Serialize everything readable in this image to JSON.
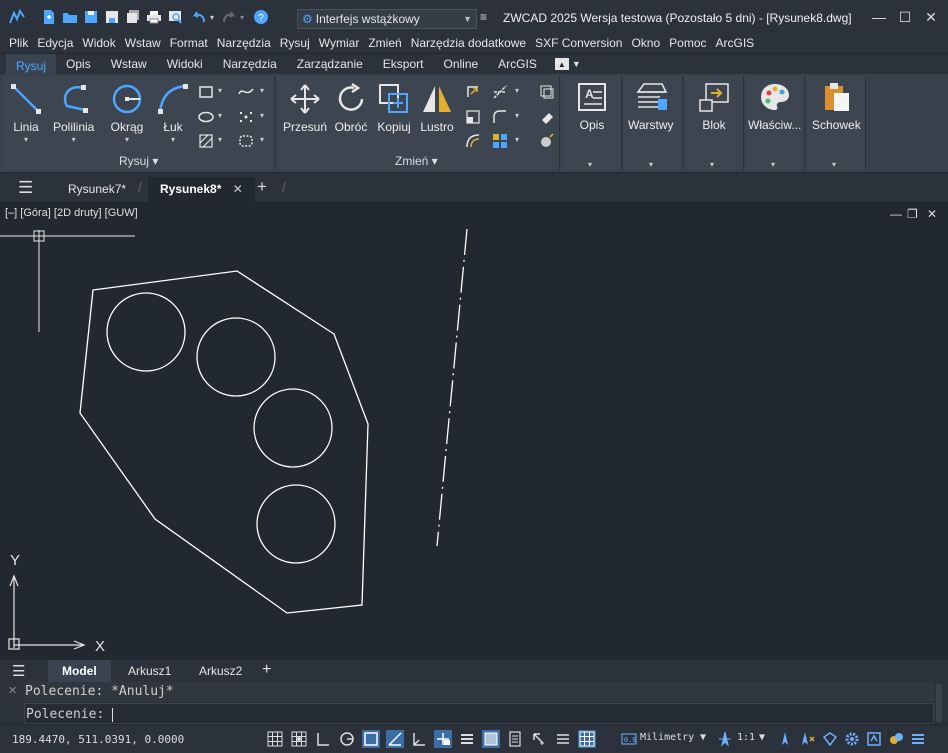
{
  "titlebar": {
    "workspace": "Interfejs wstążkowy",
    "title": "ZWCAD 2025 Wersja testowa (Pozostało 5 dni) - [Rysunek8.dwg]",
    "minimize": "—",
    "maximize": "☐",
    "close": "✕"
  },
  "menu": [
    "Plik",
    "Edycja",
    "Widok",
    "Wstaw",
    "Format",
    "Narzędzia",
    "Rysuj",
    "Wymiar",
    "Zmień",
    "Narzędzia dodatkowe",
    "SXF Conversion",
    "Okno",
    "Pomoc",
    "ArcGIS"
  ],
  "ribbon_tabs": [
    "Rysuj",
    "Opis",
    "Wstaw",
    "Widoki",
    "Narzędzia",
    "Zarządzanie",
    "Eksport",
    "Online",
    "ArcGIS"
  ],
  "ribbon": {
    "draw": {
      "line": "Linia",
      "polyline": "Polilinia",
      "circle": "Okrąg",
      "arc": "Łuk",
      "group": "Rysuj"
    },
    "modify": {
      "move": "Przesuń",
      "rotate": "Obróć",
      "copy": "Kopiuj",
      "mirror": "Lustro",
      "group": "Zmień"
    },
    "annotation": "Opis",
    "layers": "Warstwy",
    "block": "Blok",
    "properties": "Właściw...",
    "clipboard": "Schowek",
    "dropdown_arrow": "▾"
  },
  "doc_tabs": {
    "tab1": "Rysunek7*",
    "tab2": "Rysunek8*",
    "close": "✕",
    "add": "+"
  },
  "viewport": {
    "label": "[–] [Góra] [2D druty] [GUW]",
    "ucs_x": "X",
    "ucs_y": "Y",
    "min": "—",
    "restore": "❐",
    "close": "✕"
  },
  "layout_tabs": {
    "model": "Model",
    "sheet1": "Arkusz1",
    "sheet2": "Arkusz2",
    "add": "+"
  },
  "command": {
    "history": "Polecenie: *Anuluj*",
    "prompt": "Polecenie: "
  },
  "status": {
    "coords": "189.4470, 511.0391, 0.0000",
    "units": "Milimetry",
    "scale": "1:1"
  },
  "colors": {
    "accent": "#4ea6ff",
    "background": "#212830",
    "drawing": "#ffffff"
  }
}
